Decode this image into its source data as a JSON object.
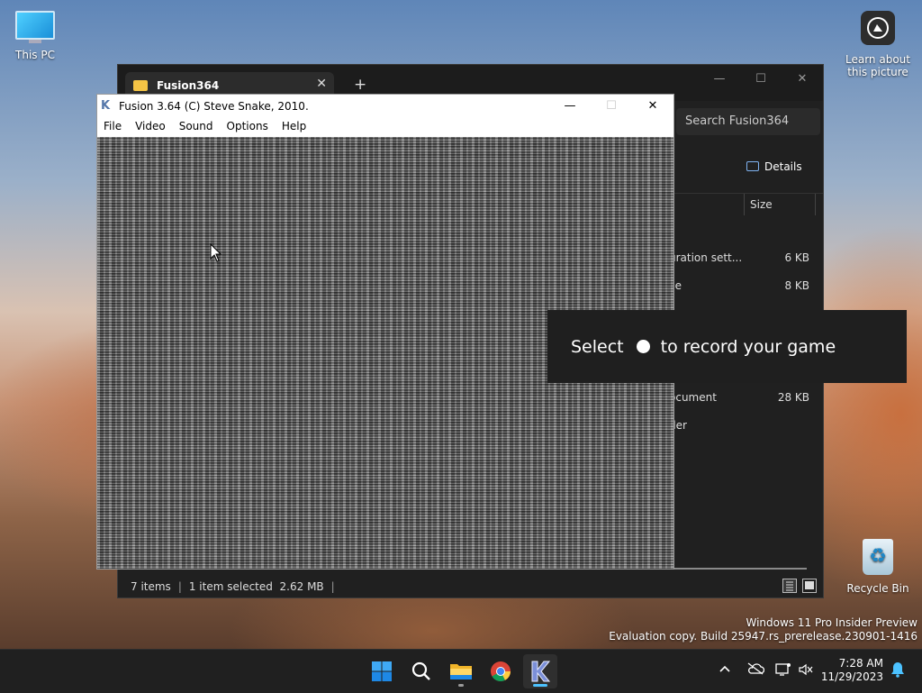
{
  "desktop": {
    "icons": {
      "this_pc": "This PC",
      "learn_line1": "Learn about",
      "learn_line2": "this picture",
      "recycle_bin": "Recycle Bin"
    },
    "watermark": {
      "line1": "Windows 11 Pro Insider Preview",
      "line2": "Evaluation copy. Build 25947.rs_prerelease.230901-1416"
    }
  },
  "explorer": {
    "tab_title": "Fusion364",
    "search_placeholder": "Search Fusion364",
    "details_label": "Details",
    "column_size": "Size",
    "rows": [
      {
        "name": "uration sett...",
        "size": "6 KB"
      },
      {
        "name": "ile",
        "size": "8 KB"
      },
      {
        "name": "ocument",
        "size": "28 KB"
      },
      {
        "name": "der",
        "size": ""
      }
    ],
    "status": {
      "items": "7 items",
      "selected": "1 item selected",
      "size": "2.62 MB"
    }
  },
  "fusion": {
    "title": "Fusion 3.64 (C) Steve Snake, 2010.",
    "menu": [
      "File",
      "Video",
      "Sound",
      "Options",
      "Help"
    ]
  },
  "toast": {
    "before": "Select",
    "after": "to record your game"
  },
  "taskbar": {
    "apps": [
      "start-icon",
      "search-icon",
      "file-explorer-icon",
      "chrome-icon",
      "kega-fusion-icon"
    ],
    "time": "7:28 AM",
    "date": "11/29/2023"
  },
  "colors": {
    "taskbar_bg": "#202020",
    "accent": "#0078d4",
    "explorer_bg": "#202020"
  }
}
